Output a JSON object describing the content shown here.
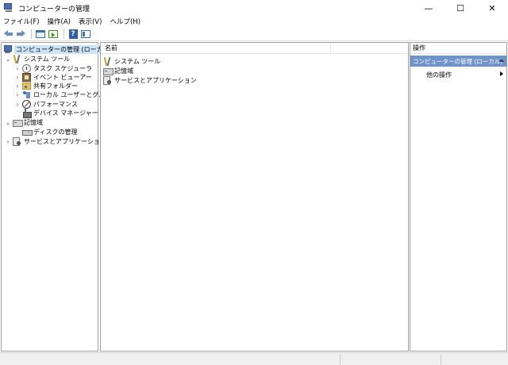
{
  "window": {
    "title": "コンピューターの管理",
    "controls": {
      "minimize": "—",
      "maximize": "☐",
      "close": "✕"
    }
  },
  "menu": [
    "ファイル(F)",
    "操作(A)",
    "表示(V)",
    "ヘルプ(H)"
  ],
  "toolbar": {
    "icons": [
      "back-arrow-icon",
      "forward-arrow-icon",
      "show-hide-tree-icon",
      "export-list-icon",
      "help-icon",
      "properties-icon"
    ]
  },
  "tree": {
    "root": "コンピューターの管理 (ローカル)",
    "items": [
      {
        "label": "システム ツール",
        "icon": "system-tools-icon"
      },
      {
        "label": "タスク スケジューラ",
        "icon": "clock-icon"
      },
      {
        "label": "イベント ビューアー",
        "icon": "event-viewer-icon"
      },
      {
        "label": "共有フォルダー",
        "icon": "shared-folder-icon"
      },
      {
        "label": "ローカル ユーザーとグループ",
        "icon": "users-icon"
      },
      {
        "label": "パフォーマンス",
        "icon": "performance-icon"
      },
      {
        "label": "デバイス マネージャー",
        "icon": "device-manager-icon"
      },
      {
        "label": "記憶域",
        "icon": "storage-icon"
      },
      {
        "label": "ディスクの管理",
        "icon": "disk-icon"
      },
      {
        "label": "サービスとアプリケーション",
        "icon": "services-icon"
      }
    ]
  },
  "main": {
    "column_header": "名前",
    "rows": [
      {
        "label": "システム ツール",
        "icon": "system-tools-icon"
      },
      {
        "label": "記憶域",
        "icon": "storage-icon"
      },
      {
        "label": "サービスとアプリケーション",
        "icon": "services-icon"
      }
    ]
  },
  "actions": {
    "header": "操作",
    "section": "コンピューターの管理 (ローカル)",
    "item": "他の操作"
  }
}
